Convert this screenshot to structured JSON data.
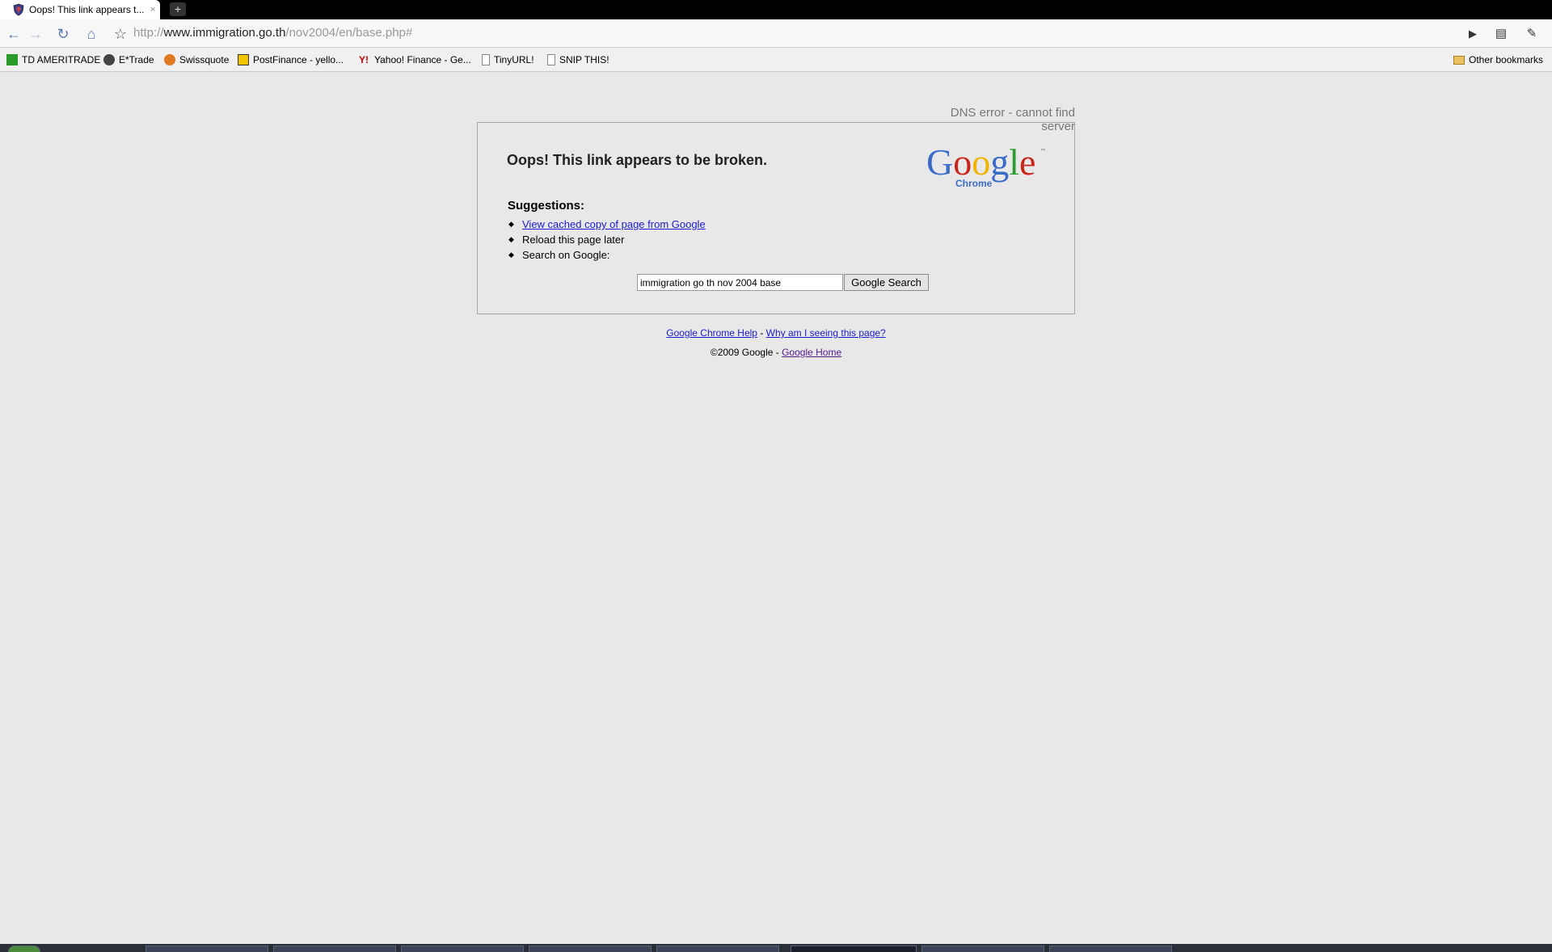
{
  "tab": {
    "title": "Oops! This link appears t...",
    "close": "×",
    "new_tab": "+"
  },
  "toolbar": {
    "back_icon": "←",
    "forward_icon": "→",
    "reload_icon": "↻",
    "home_icon": "⌂",
    "star_icon": "☆",
    "go_icon": "▶",
    "page_icon": "▤",
    "wrench_icon": "✎"
  },
  "omnibox": {
    "scheme": "http://",
    "host": "www.immigration.go.th",
    "path": "/nov2004/en/base.php#"
  },
  "bookmarks": {
    "items": [
      {
        "label": "TD AMERITRADE"
      },
      {
        "label": "E*Trade"
      },
      {
        "label": "Swissquote"
      },
      {
        "label": "PostFinance - yello..."
      },
      {
        "label": "Yahoo! Finance - Ge..."
      },
      {
        "label": "TinyURL!"
      },
      {
        "label": "SNIP THIS!"
      }
    ],
    "other": "Other bookmarks"
  },
  "error": {
    "dns_label": "DNS error - cannot find server",
    "title": "Oops! This link appears to be broken.",
    "suggestions_heading": "Suggestions:",
    "suggestions": {
      "cached": "View cached copy of page from Google",
      "reload": "Reload this page later",
      "search": "Search on Google:"
    },
    "search_value": "immigration go th nov 2004 base",
    "search_button": "Google Search",
    "logo_text": "Google",
    "logo_sub": "Chrome",
    "logo_tm": "™"
  },
  "footer": {
    "help": "Google Chrome Help",
    "separator": " - ",
    "why": "Why am I seeing this page?",
    "copyright": "©2009 Google - ",
    "home": "Google Home"
  },
  "colors": {
    "link": "#1a1acc",
    "visited": "#551a8b",
    "page_bg": "#e8e8e8"
  }
}
